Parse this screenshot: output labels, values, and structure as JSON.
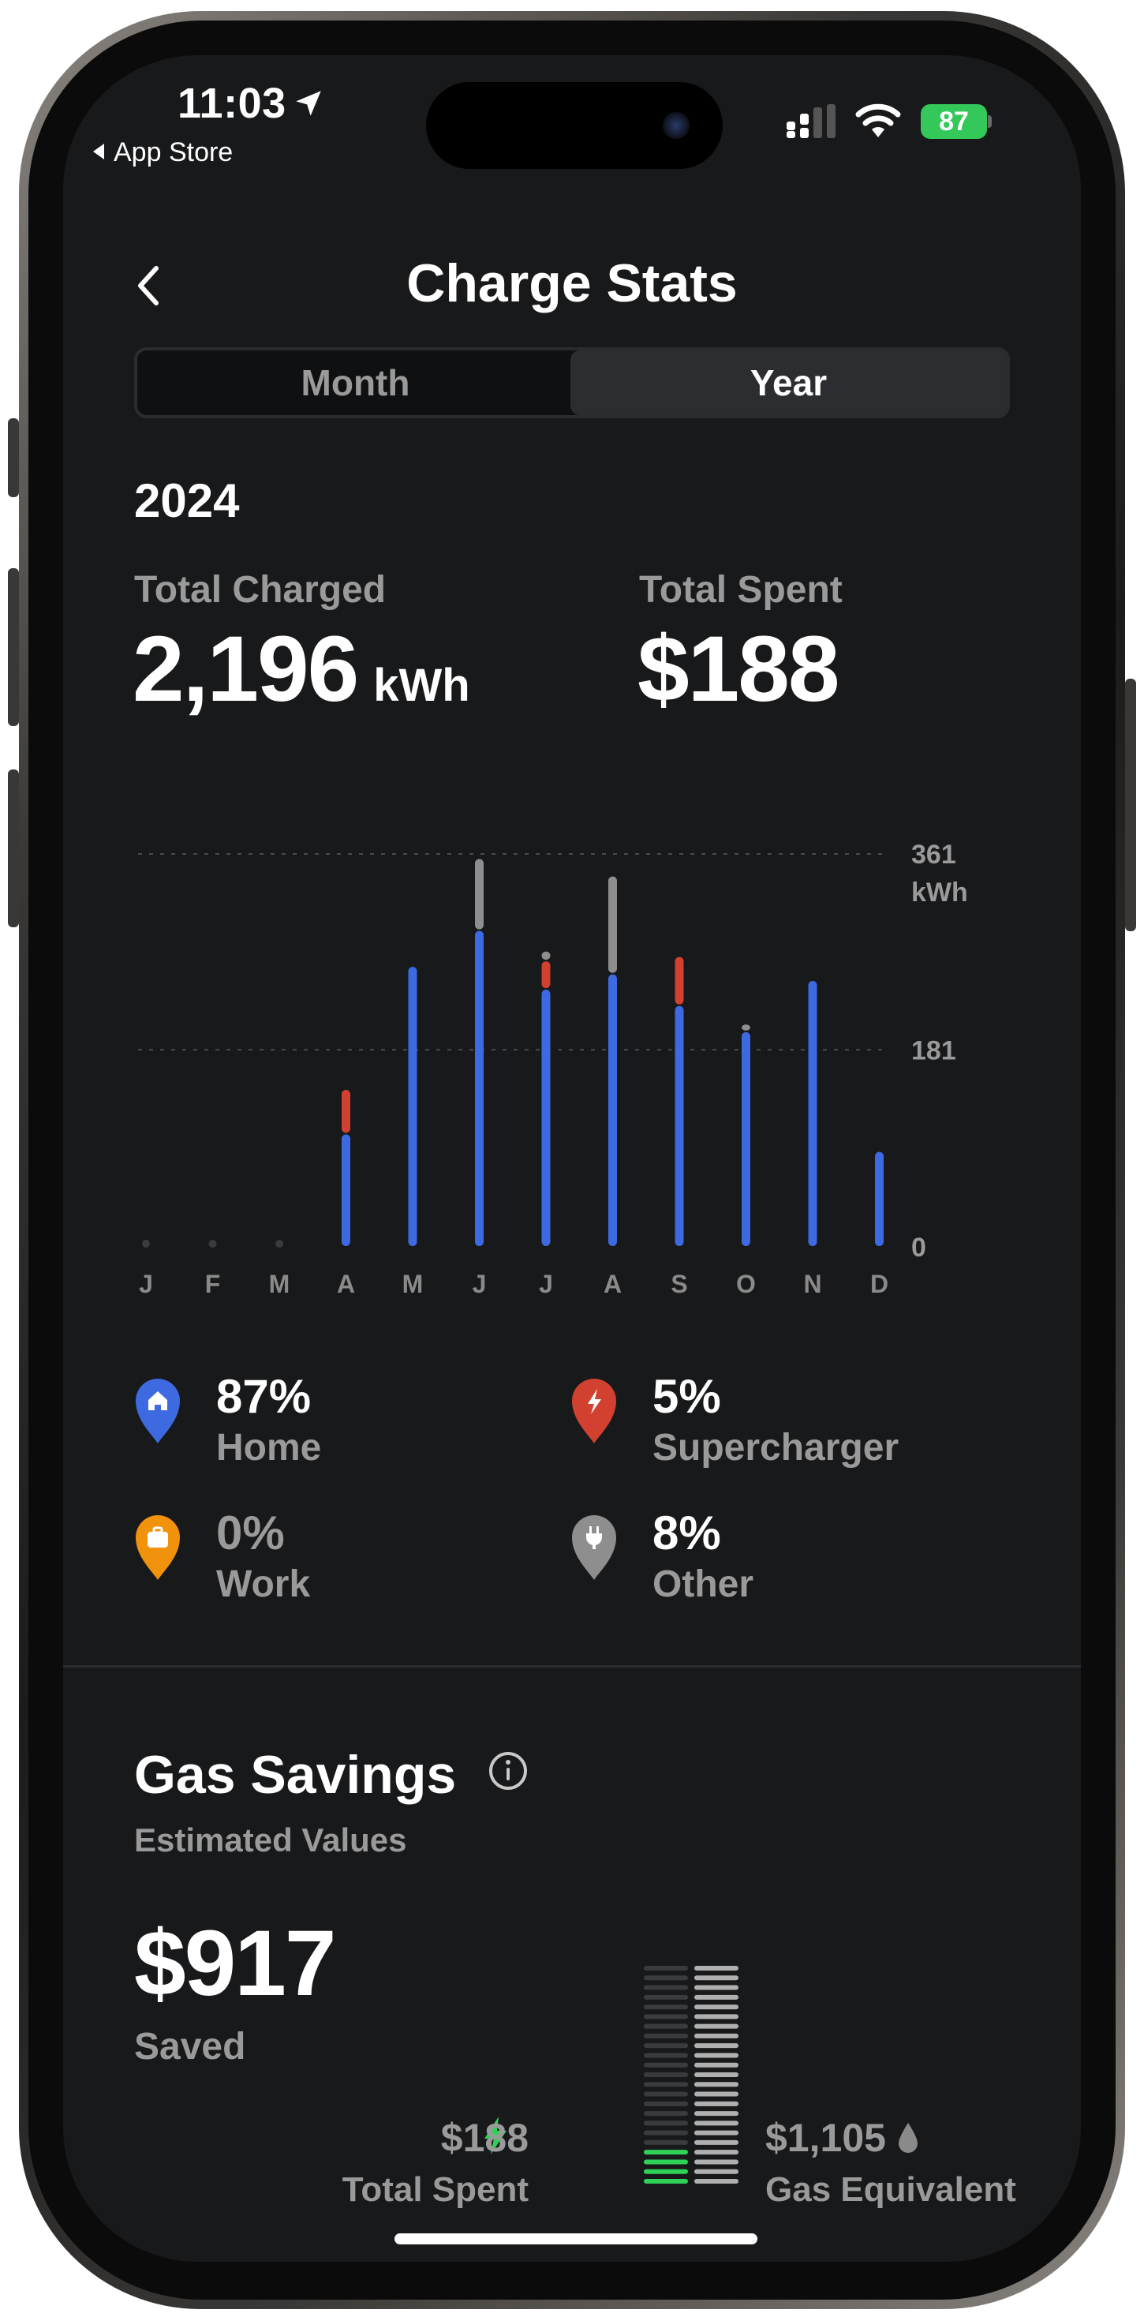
{
  "status_bar": {
    "time": "11:03",
    "back_app": "App Store",
    "battery": "87"
  },
  "header": {
    "title": "Charge Stats"
  },
  "segments": {
    "month": "Month",
    "year": "Year",
    "selected": "Year"
  },
  "year": "2024",
  "totals": {
    "charged_label": "Total Charged",
    "charged_value": "2,196",
    "charged_unit": "kWh",
    "spent_label": "Total Spent",
    "spent_value": "$188"
  },
  "chart_data": {
    "type": "bar",
    "stacked": true,
    "categories": [
      "J",
      "F",
      "M",
      "A",
      "M",
      "J",
      "J",
      "A",
      "S",
      "O",
      "N",
      "D"
    ],
    "series": [
      {
        "name": "Home",
        "color": "#3e6ae1",
        "values": [
          0,
          0,
          0,
          104,
          258,
          291,
          237,
          251,
          222,
          198,
          245,
          88
        ]
      },
      {
        "name": "Supercharger",
        "color": "#d2402f",
        "values": [
          0,
          0,
          0,
          41,
          0,
          0,
          26,
          0,
          45,
          0,
          0,
          0
        ]
      },
      {
        "name": "Other",
        "color": "#8e8e8e",
        "values": [
          0,
          0,
          0,
          0,
          0,
          66,
          9,
          90,
          0,
          7,
          0,
          0
        ]
      }
    ],
    "y_ticks": [
      "0",
      "181",
      "361"
    ],
    "y_max_label": "361",
    "y_unit": "kWh",
    "ylim": [
      0,
      361
    ],
    "grid": true
  },
  "legend": [
    {
      "pct": "87%",
      "name": "Home",
      "color": "#3e6ae1",
      "icon": "home-icon",
      "dim": false
    },
    {
      "pct": "5%",
      "name": "Supercharger",
      "color": "#d2402f",
      "icon": "bolt-icon",
      "dim": false
    },
    {
      "pct": "0%",
      "name": "Work",
      "color": "#f0920c",
      "icon": "briefcase-icon",
      "dim": true
    },
    {
      "pct": "8%",
      "name": "Other",
      "color": "#8e8e8e",
      "icon": "plug-icon",
      "dim": false
    }
  ],
  "gas_savings": {
    "title": "Gas Savings",
    "subtitle": "Estimated Values",
    "saved_value": "$917",
    "saved_label": "Saved",
    "spent_value": "$188",
    "spent_label": "Total Spent",
    "gas_value": "$1,105",
    "gas_label": "Gas Equivalent",
    "spent_amount": 188,
    "gas_amount": 1105,
    "accent": "#30d158"
  }
}
